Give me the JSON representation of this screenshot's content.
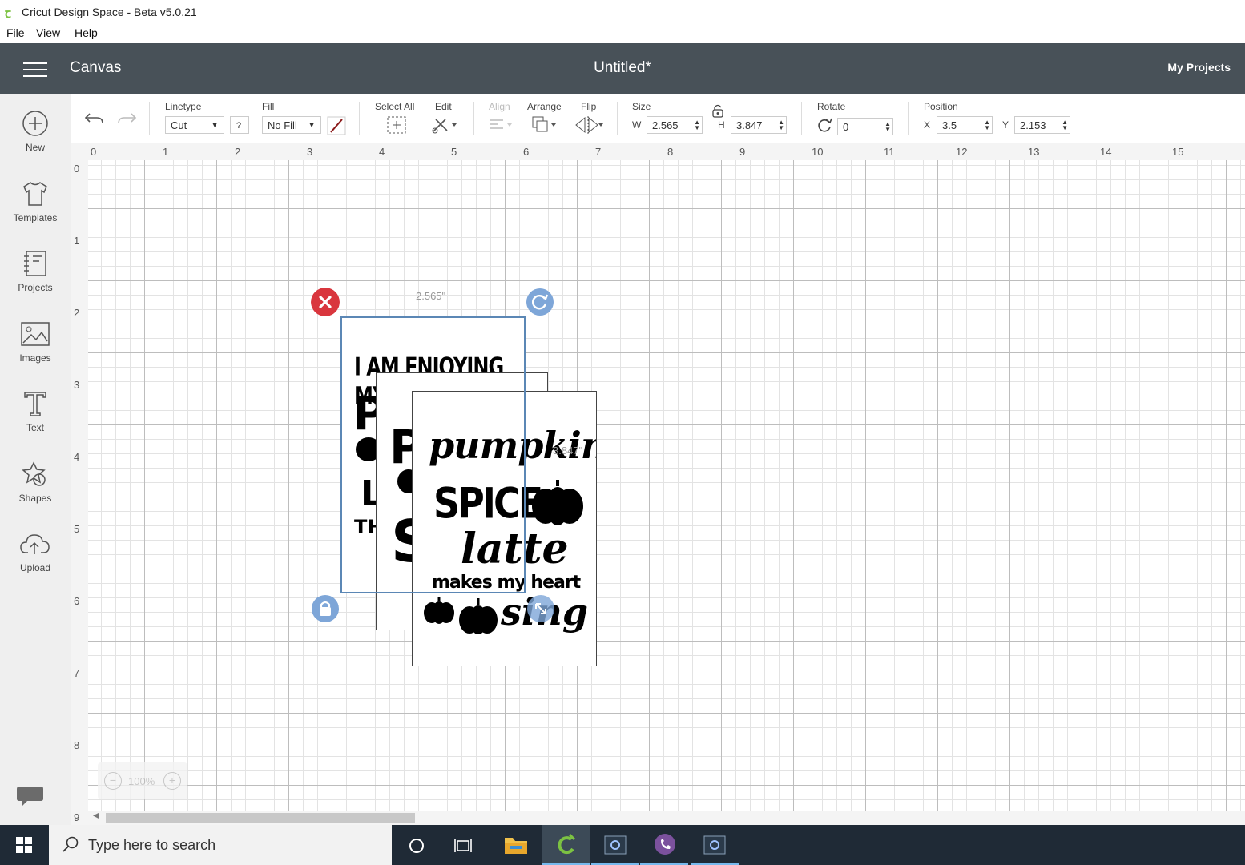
{
  "window": {
    "title": "Cricut Design Space - Beta v5.0.21"
  },
  "menu": {
    "items": [
      "File",
      "View",
      "Help"
    ]
  },
  "header": {
    "section": "Canvas",
    "document_title": "Untitled*",
    "my_projects": "My Projects"
  },
  "toolbar": {
    "linetype_label": "Linetype",
    "linetype_value": "Cut",
    "help_mark": "?",
    "fill_label": "Fill",
    "fill_value": "No Fill",
    "select_all_label": "Select All",
    "edit_label": "Edit",
    "align_label": "Align",
    "arrange_label": "Arrange",
    "flip_label": "Flip",
    "size_label": "Size",
    "w_label": "W",
    "w_value": "2.565",
    "h_label": "H",
    "h_value": "3.847",
    "rotate_label": "Rotate",
    "rotate_value": "0",
    "position_label": "Position",
    "x_label": "X",
    "x_value": "3.5",
    "y_label": "Y",
    "y_value": "2.153"
  },
  "sidebar": {
    "items": [
      {
        "label": "New",
        "icon": "plus-circle-icon"
      },
      {
        "label": "Templates",
        "icon": "tshirt-icon"
      },
      {
        "label": "Projects",
        "icon": "notebook-icon"
      },
      {
        "label": "Images",
        "icon": "image-icon"
      },
      {
        "label": "Text",
        "icon": "text-t-icon"
      },
      {
        "label": "Shapes",
        "icon": "shapes-icon"
      },
      {
        "label": "Upload",
        "icon": "cloud-upload-icon"
      }
    ]
  },
  "ruler": {
    "top": [
      "0",
      "1",
      "2",
      "3",
      "4",
      "5",
      "6",
      "7",
      "8",
      "9",
      "10",
      "11",
      "12",
      "13",
      "14",
      "15"
    ],
    "left": [
      "0",
      "1",
      "2",
      "3",
      "4",
      "5",
      "6",
      "7",
      "8",
      "9"
    ]
  },
  "selection": {
    "width_dim": "2.565\"",
    "height_dim": "3.847\""
  },
  "designs": {
    "back_card": {
      "line1": "I AM ENJOYING MY",
      "p": "P",
      "l": "L",
      "th": "TH"
    },
    "mid_card": {
      "p": "P",
      "s": "S"
    },
    "front_card": {
      "line1": "pumpkin",
      "line2": "SPICE",
      "line3": "latte",
      "line4": "makes my heart",
      "line5": "sing"
    }
  },
  "zoom": {
    "value": "100%",
    "minus": "−",
    "plus": "+"
  },
  "taskbar": {
    "search_placeholder": "Type here to search"
  },
  "colors": {
    "header_bg": "#485158",
    "accent_green": "#7cc242",
    "delete_red": "#d9363e",
    "handle_blue": "#7ea6d8",
    "selection_blue": "#5b87b5"
  }
}
